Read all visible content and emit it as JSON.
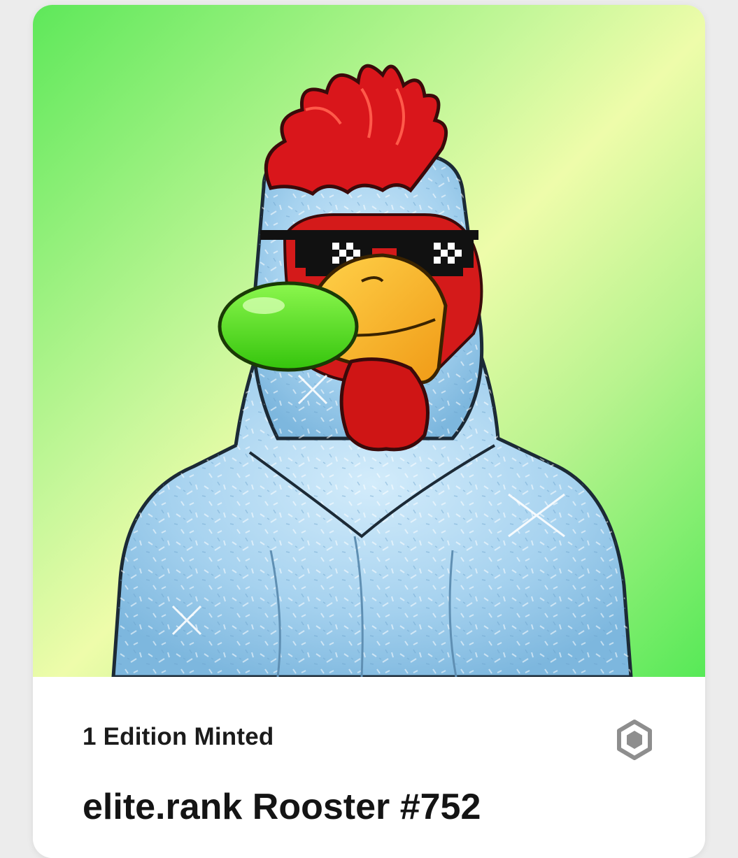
{
  "nft_card": {
    "image_alt": "Rooster NFT artwork",
    "edition_text": "1 Edition Minted",
    "title": "elite.rank Rooster #752",
    "chain_icon": "polygon-hexagon-icon"
  },
  "colors": {
    "background_green": "#5ee85a",
    "background_yellow": "#eefcaa",
    "rooster_body": "#a9d4f0",
    "comb_red": "#d9161b",
    "beak_orange": "#f7a51e",
    "bubblegum_green": "#4fe019"
  }
}
